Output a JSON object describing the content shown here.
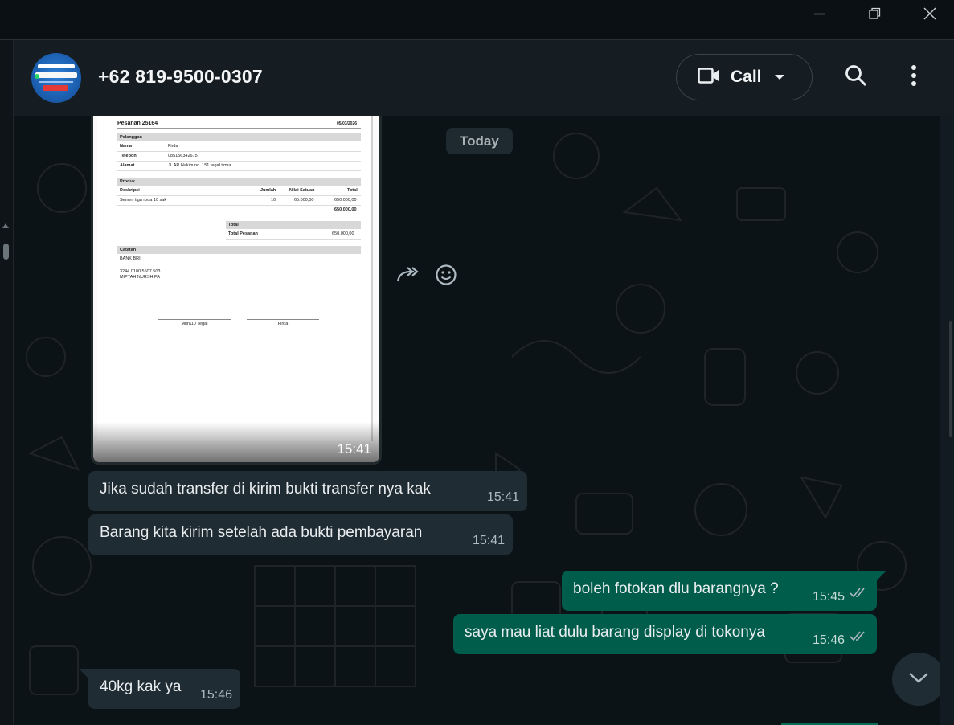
{
  "window": {
    "minimize_icon": "minimize-icon",
    "maximize_icon": "restore-icon",
    "close_icon": "close-icon"
  },
  "header": {
    "contact_name": "+62 819-9500-0307",
    "call_label": "Call",
    "icons": [
      "video-camera-icon",
      "chevron-down-icon",
      "search-icon",
      "more-vertical-icon"
    ]
  },
  "chat": {
    "date_chip": "Today",
    "image_message": {
      "time": "15:41",
      "document": {
        "title": "Pesanan 25164",
        "date": "05/03/2026",
        "customer_section": "Pelanggan",
        "customer_rows": [
          {
            "key": "Nama",
            "value": "Firda"
          },
          {
            "key": "Telepon",
            "value": "085156342675"
          },
          {
            "key": "Alamat",
            "value": "Jl. AR Hakim no. 151 tegal timur"
          }
        ],
        "product_section": "Produk",
        "product_headers": [
          "Deskripsi",
          "Jumlah",
          "Nilai Satuan",
          "Total"
        ],
        "product_row": [
          "Semen tiga roda 10 sak",
          "10",
          "65.000,00",
          "650.000,00"
        ],
        "product_subtotal": "650.000,00",
        "total_section": "Total",
        "total_label": "Total Pesanan",
        "total_value": "650.000,00",
        "notes_section": "Catatan",
        "notes_line1": "BANK BRI",
        "notes_line2": "3244 0100 5507 503",
        "notes_line3": "MIPTAH NURSHIPA",
        "signature_left": "Mitra10 Tegal",
        "signature_right": "Firda"
      }
    },
    "messages": [
      {
        "direction": "in",
        "text": "Jika sudah transfer di kirim bukti transfer nya kak",
        "time": "15:41"
      },
      {
        "direction": "in",
        "text": "Barang kita kirim setelah ada bukti pembayaran",
        "time": "15:41"
      },
      {
        "direction": "out",
        "text": "boleh fotokan dlu barangnya ?",
        "time": "15:45",
        "status": "read"
      },
      {
        "direction": "out",
        "text": "saya mau liat dulu barang display di tokonya",
        "time": "15:46",
        "status": "read"
      },
      {
        "direction": "in",
        "text": "40kg kak ya",
        "time": "15:46"
      }
    ],
    "colors": {
      "incoming_bubble": "#202c33",
      "outgoing_bubble": "#005c4b",
      "background": "#0c1317"
    }
  }
}
